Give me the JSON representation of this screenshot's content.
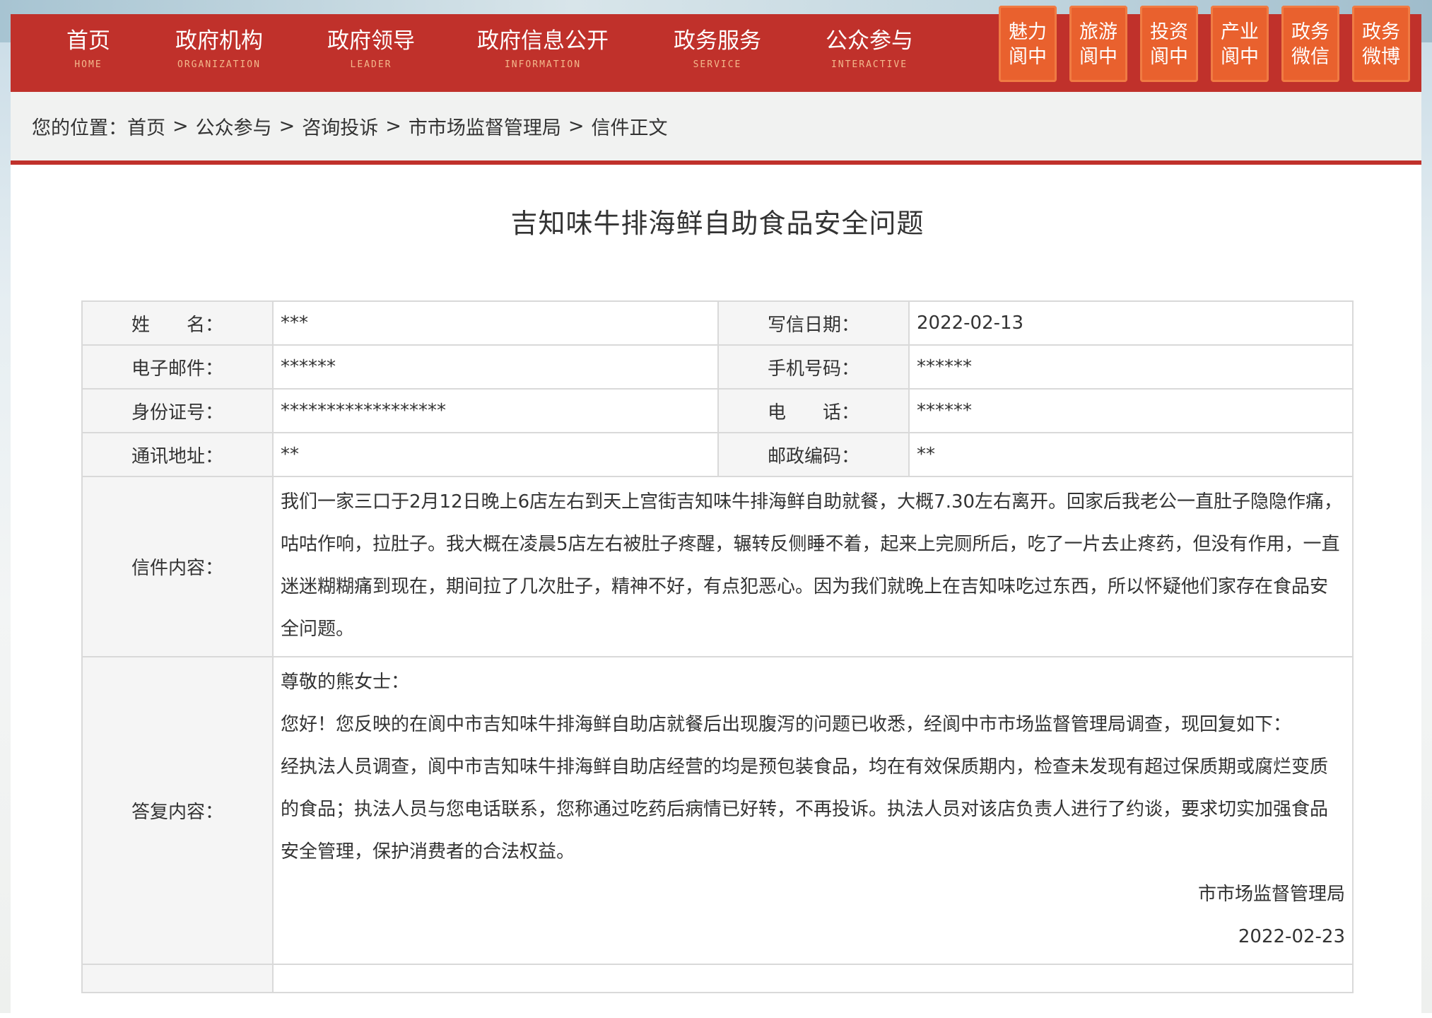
{
  "nav": {
    "items": [
      {
        "cn": "首页",
        "en": "HOME"
      },
      {
        "cn": "政府机构",
        "en": "ORGANIZATION"
      },
      {
        "cn": "政府领导",
        "en": "LEADER"
      },
      {
        "cn": "政府信息公开",
        "en": "INFORMATION"
      },
      {
        "cn": "政务服务",
        "en": "SERVICE"
      },
      {
        "cn": "公众参与",
        "en": "INTERACTIVE"
      }
    ],
    "tiles": [
      {
        "l1": "魅力",
        "l2": "阆中"
      },
      {
        "l1": "旅游",
        "l2": "阆中"
      },
      {
        "l1": "投资",
        "l2": "阆中"
      },
      {
        "l1": "产业",
        "l2": "阆中"
      },
      {
        "l1": "政务",
        "l2": "微信"
      },
      {
        "l1": "政务",
        "l2": "微博"
      }
    ]
  },
  "breadcrumb": {
    "prefix": "您的位置：",
    "items": [
      "首页",
      "公众参与",
      "咨询投诉",
      "市市场监督管理局",
      "信件正文"
    ],
    "sep": ">"
  },
  "letter": {
    "title": "吉知味牛排海鲜自助食品安全问题",
    "labels": {
      "name": "姓　　名：",
      "date": "写信日期：",
      "email": "电子邮件：",
      "mobile": "手机号码：",
      "idno": "身份证号：",
      "phone": "电　　话：",
      "address": "通讯地址：",
      "postcode": "邮政编码：",
      "content": "信件内容：",
      "reply": "答复内容："
    },
    "values": {
      "name": "***",
      "date": "2022-02-13",
      "email": "******",
      "mobile": "******",
      "idno": "******************",
      "phone": "******",
      "address": "**",
      "postcode": "**"
    },
    "content": "我们一家三口于2月12日晚上6店左右到天上宫街吉知味牛排海鲜自助就餐，大概7.30左右离开。回家后我老公一直肚子隐隐作痛，咕咕作响，拉肚子。我大概在凌晨5店左右被肚子疼醒，辗转反侧睡不着，起来上完厕所后，吃了一片去止疼药，但没有作用，一直迷迷糊糊痛到现在，期间拉了几次肚子，精神不好，有点犯恶心。因为我们就晚上在吉知味吃过东西，所以怀疑他们家存在食品安全问题。",
    "reply": {
      "greeting": "尊敬的熊女士：",
      "p1": "您好！您反映的在阆中市吉知味牛排海鲜自助店就餐后出现腹泻的问题已收悉，经阆中市市场监督管理局调查，现回复如下：",
      "p2": "经执法人员调查，阆中市吉知味牛排海鲜自助店经营的均是预包装食品，均在有效保质期内，检查未发现有超过保质期或腐烂变质的食品；执法人员与您电话联系，您称通过吃药后病情已好转，不再投诉。执法人员对该店负责人进行了约谈，要求切实加强食品安全管理，保护消费者的合法权益。",
      "signer": "市市场监督管理局",
      "date": "2022-02-23"
    }
  },
  "colors": {
    "nav_red": "#c0312b",
    "tile_orange": "#e9612e",
    "en_label": "#f3b98c"
  }
}
